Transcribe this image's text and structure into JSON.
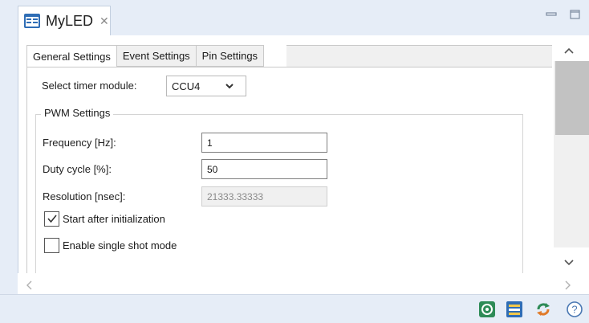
{
  "editor": {
    "title": "MyLED",
    "close_glyph": "✕"
  },
  "tabs": [
    {
      "label": "General Settings",
      "active": true
    },
    {
      "label": "Event Settings",
      "active": false
    },
    {
      "label": "Pin Settings",
      "active": false
    }
  ],
  "timer": {
    "label": "Select timer module:",
    "value": "CCU4"
  },
  "pwm": {
    "group_title": "PWM Settings",
    "frequency_label": "Frequency [Hz]:",
    "frequency_value": "1",
    "duty_label": "Duty cycle [%]:",
    "duty_value": "50",
    "resolution_label": "Resolution [nsec]:",
    "resolution_value": "21333.33333",
    "start_label": "Start after initialization",
    "start_checked": true,
    "singleshot_label": "Enable single shot mode",
    "singleshot_checked": false
  },
  "toolbar": {
    "icons": [
      "generate-code-icon",
      "pin-allocator-icon",
      "refresh-icon",
      "help-icon"
    ]
  },
  "colors": {
    "chrome": "#e6edf7",
    "accent_green": "#2e8b57",
    "accent_blue": "#2f6db5"
  }
}
